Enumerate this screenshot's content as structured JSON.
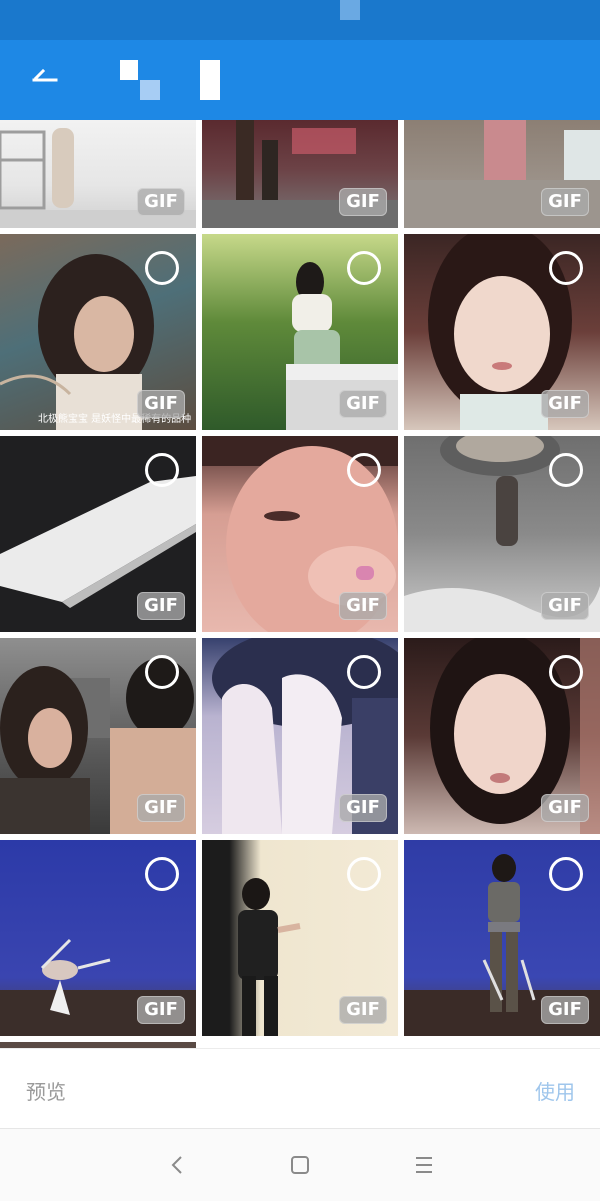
{
  "app": {
    "status_bar_color": "#1a78cc",
    "toolbar_color": "#1e88e5",
    "back_icon": "back-arrow-icon"
  },
  "grid": {
    "badge_text": "GIF",
    "tiles": [
      {
        "name": "tile-r0c0",
        "gif": true,
        "selectable": false
      },
      {
        "name": "tile-r0c1",
        "gif": true,
        "selectable": false
      },
      {
        "name": "tile-r0c2",
        "gif": true,
        "selectable": false
      },
      {
        "name": "tile-r1c0",
        "gif": true,
        "selectable": true,
        "caption": "北极熊宝宝 是妖怪中最稀有的品种"
      },
      {
        "name": "tile-r1c1",
        "gif": true,
        "selectable": true
      },
      {
        "name": "tile-r1c2",
        "gif": true,
        "selectable": true
      },
      {
        "name": "tile-r2c0",
        "gif": true,
        "selectable": true
      },
      {
        "name": "tile-r2c1",
        "gif": true,
        "selectable": true
      },
      {
        "name": "tile-r2c2",
        "gif": true,
        "selectable": true
      },
      {
        "name": "tile-r3c0",
        "gif": true,
        "selectable": true
      },
      {
        "name": "tile-r3c1",
        "gif": true,
        "selectable": true
      },
      {
        "name": "tile-r3c2",
        "gif": true,
        "selectable": true
      },
      {
        "name": "tile-r4c0",
        "gif": true,
        "selectable": true
      },
      {
        "name": "tile-r4c1",
        "gif": true,
        "selectable": true
      },
      {
        "name": "tile-r4c2",
        "gif": true,
        "selectable": true
      }
    ]
  },
  "bottom_bar": {
    "preview_label": "预览",
    "use_label": "使用",
    "use_color": "#9fc6ec"
  },
  "nav_bar": {
    "icons": [
      "nav-back-icon",
      "nav-home-icon",
      "nav-menu-icon"
    ]
  }
}
